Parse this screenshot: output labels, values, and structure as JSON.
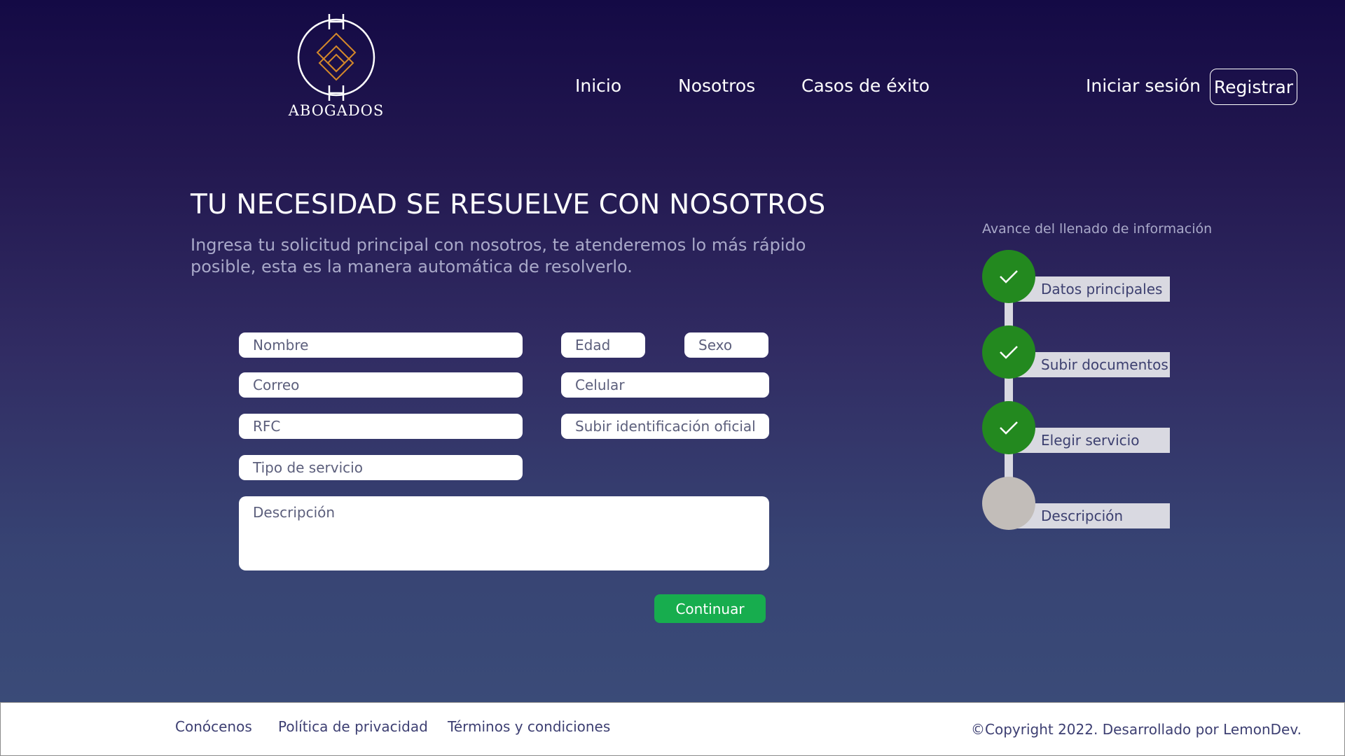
{
  "brand": {
    "logo_text": "ABOGADOS"
  },
  "nav": {
    "inicio": "Inicio",
    "nosotros": "Nosotros",
    "casos": "Casos de éxito",
    "login": "Iniciar sesión",
    "register": "Registrar"
  },
  "hero": {
    "headline": "TU NECESIDAD SE RESUELVE CON NOSOTROS",
    "subtitle": "Ingresa tu solicitud principal con nosotros, te atenderemos lo más rápido posible, esta es la manera automática de resolverlo."
  },
  "form": {
    "nombre": "Nombre",
    "edad": "Edad",
    "sexo": "Sexo",
    "correo": "Correo",
    "celular": "Celular",
    "rfc": "RFC",
    "identificacion": "Subir identificación oficial",
    "tipo_servicio": "Tipo de servicio",
    "descripcion": "Descripción",
    "continue_label": "Continuar"
  },
  "progress": {
    "title": "Avance del llenado de información",
    "steps": [
      {
        "label": "Datos principales",
        "status": "done"
      },
      {
        "label": "Subir documentos",
        "status": "done"
      },
      {
        "label": "Elegir servicio",
        "status": "done"
      },
      {
        "label": "Descripción",
        "status": "pending"
      }
    ],
    "colors": {
      "done": "#23891f",
      "pending": "#c2bdb9"
    }
  },
  "footer": {
    "conocenos": "Conócenos",
    "privacidad": "Política de privacidad",
    "terminos": "Términos y condiciones",
    "copyright": "©Copyright 2022. Desarrollado por LemonDev."
  },
  "icons": {
    "step_check": "check-icon",
    "logo": "diamond-emblem-icon"
  },
  "theme": {
    "accent_green": "#17ad4e",
    "hero_top": "#140a45",
    "hero_bottom": "#3a4b78",
    "logo_gold": "#d4882a"
  }
}
